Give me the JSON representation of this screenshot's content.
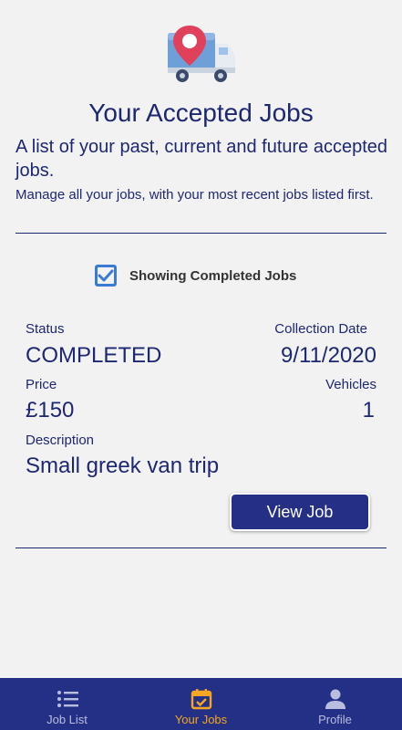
{
  "header": {
    "title": "Your Accepted Jobs",
    "subtitle": "A list of your past, current and future accepted jobs.",
    "description": "Manage all your jobs, with your most recent jobs listed first."
  },
  "filter": {
    "checked": true,
    "label": "Showing Completed Jobs"
  },
  "job": {
    "status_label": "Status",
    "status_value": "COMPLETED",
    "collection_label": "Collection Date",
    "collection_value": "9/11/2020",
    "price_label": "Price",
    "price_value": "£150",
    "vehicles_label": "Vehicles",
    "vehicles_value": "1",
    "description_label": "Description",
    "description_value": "Small greek van trip",
    "view_button": "View Job"
  },
  "nav": {
    "items": [
      {
        "label": "Job List",
        "icon": "list-icon",
        "active": false
      },
      {
        "label": "Your Jobs",
        "icon": "calendar-check-icon",
        "active": true
      },
      {
        "label": "Profile",
        "icon": "person-icon",
        "active": false
      }
    ]
  },
  "colors": {
    "primary": "#1e2772",
    "nav_bg": "#233085",
    "active": "#f5a623",
    "checkbox": "#3a7bd5"
  }
}
